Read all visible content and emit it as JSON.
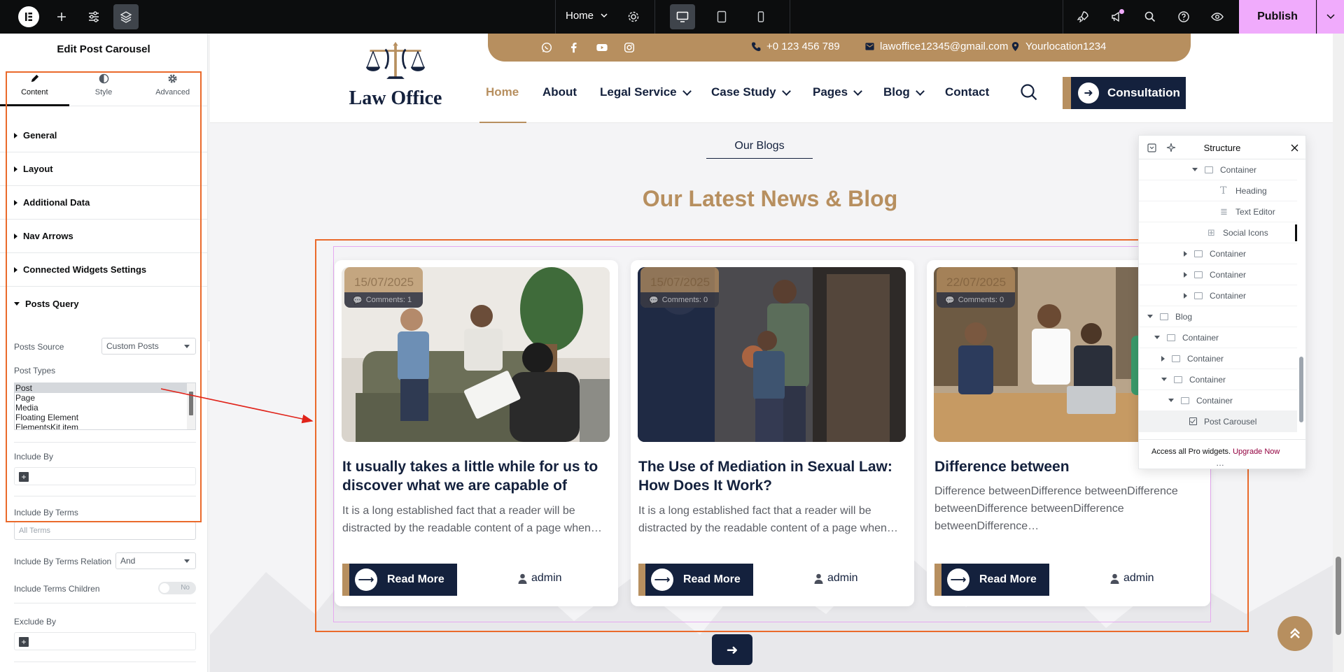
{
  "topbar": {
    "page_name": "Home",
    "publish_label": "Publish"
  },
  "panel": {
    "title": "Edit Post Carousel",
    "tabs": [
      {
        "label": "Content",
        "icon": "pencil-icon"
      },
      {
        "label": "Style",
        "icon": "contrast-icon"
      },
      {
        "label": "Advanced",
        "icon": "gear-icon"
      }
    ],
    "sections": [
      "General",
      "Layout",
      "Additional Data",
      "Nav Arrows",
      "Connected Widgets Settings",
      "Posts Query"
    ],
    "posts_source_label": "Posts Source",
    "posts_source_value": "Custom Posts",
    "post_types_label": "Post Types",
    "post_types_options": [
      "Post",
      "Page",
      "Media",
      "Floating Element",
      "ElementsKit item"
    ],
    "include_by_label": "Include By",
    "include_by_terms_label": "Include By Terms",
    "include_by_terms_placeholder": "All Terms",
    "terms_relation_label": "Include By Terms Relation",
    "terms_relation_value": "And",
    "terms_children_label": "Include Terms Children",
    "terms_children_value": "No",
    "exclude_by_label": "Exclude By",
    "plus": "+"
  },
  "site": {
    "phone": "+0 123 456 789",
    "email": "lawoffice12345@gmail.com",
    "location": "Yourlocation1234",
    "logo_text": "Law Office",
    "nav": [
      {
        "label": "Home",
        "active": true,
        "dropdown": false
      },
      {
        "label": "About",
        "active": false,
        "dropdown": false
      },
      {
        "label": "Legal Service",
        "active": false,
        "dropdown": true
      },
      {
        "label": "Case Study",
        "active": false,
        "dropdown": true
      },
      {
        "label": "Pages",
        "active": false,
        "dropdown": true
      },
      {
        "label": "Blog",
        "active": false,
        "dropdown": true
      },
      {
        "label": "Contact",
        "active": false,
        "dropdown": false
      }
    ],
    "cta_label": "Consultation",
    "sub_heading": "Our Blogs",
    "main_heading": "Our Latest News & Blog",
    "posts": [
      {
        "date": "15/07/2025",
        "comments": "Comments: 1",
        "title": "It usually takes a little while for us to discover what we are capable of",
        "excerpt": "It is a long established fact that a reader will be distracted by the readable content of a page when…",
        "read_more": "Read More",
        "author": "admin"
      },
      {
        "date": "15/07/2025",
        "comments": "Comments: 0",
        "title": "The Use of Mediation in Sexual Law: How Does It Work?",
        "excerpt": "It is a long established fact that a reader will be distracted by the readable content of a page when…",
        "read_more": "Read More",
        "author": "admin"
      },
      {
        "date": "22/07/2025",
        "comments": "Comments: 0",
        "title": "Difference between",
        "excerpt": "Difference betweenDifference betweenDifference betweenDifference betweenDifference betweenDifference…",
        "read_more": "Read More",
        "author": "admin"
      }
    ]
  },
  "structure": {
    "title": "Structure",
    "items": [
      {
        "label": "Container",
        "twisty": "down",
        "icon": "box"
      },
      {
        "label": "Heading",
        "twisty": "",
        "icon": "heading"
      },
      {
        "label": "Text Editor",
        "twisty": "",
        "icon": "text"
      },
      {
        "label": "Social Icons",
        "twisty": "",
        "icon": "grid"
      },
      {
        "label": "Container",
        "twisty": "right",
        "icon": "box"
      },
      {
        "label": "Container",
        "twisty": "right",
        "icon": "box"
      },
      {
        "label": "Container",
        "twisty": "right",
        "icon": "box"
      },
      {
        "label": "Blog",
        "twisty": "down",
        "icon": "box"
      },
      {
        "label": "Container",
        "twisty": "down",
        "icon": "box"
      },
      {
        "label": "Container",
        "twisty": "right",
        "icon": "box"
      },
      {
        "label": "Container",
        "twisty": "down",
        "icon": "box"
      },
      {
        "label": "Container",
        "twisty": "down",
        "icon": "box"
      },
      {
        "label": "Post Carousel",
        "twisty": "",
        "icon": "check",
        "selected": true
      }
    ],
    "footer_text": "Access all Pro widgets.",
    "footer_link": "Upgrade Now",
    "more": "…"
  },
  "colors": {
    "accent_gold": "#b78f5f",
    "navy": "#14213d",
    "selection_orange": "#ea6a2b",
    "publish_pink": "#f0abfc",
    "arrow_red": "#e0231a"
  }
}
